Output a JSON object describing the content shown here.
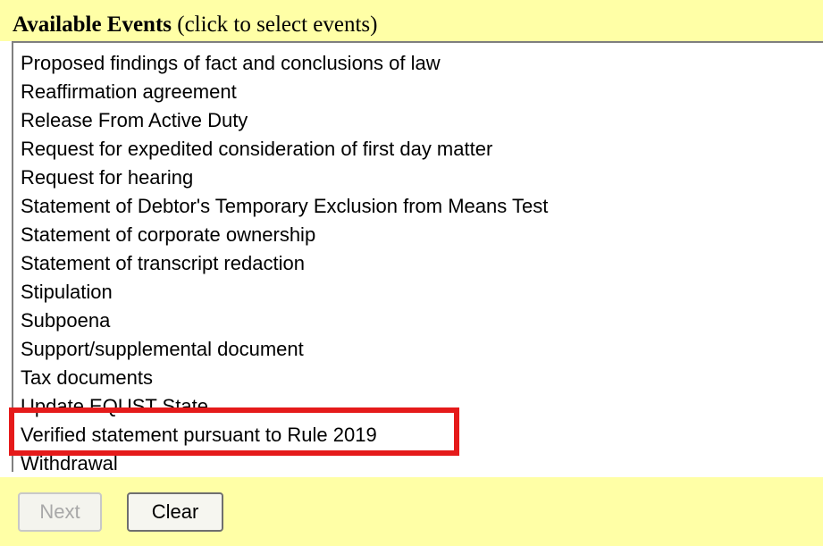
{
  "header": {
    "title": "Available Events",
    "hint": "(click to select events)"
  },
  "events": [
    "Proposed findings of fact and conclusions of law",
    "Reaffirmation agreement",
    "Release From Active Duty",
    "Request for expedited consideration of first day matter",
    "Request for hearing",
    "Statement of Debtor's Temporary Exclusion from Means Test",
    "Statement of corporate ownership",
    "Statement of transcript redaction",
    "Stipulation",
    "Subpoena",
    "Support/supplemental document",
    "Tax documents",
    "Update EQUST State",
    "Verified statement pursuant to Rule 2019",
    "Withdrawal"
  ],
  "buttons": {
    "next_label": "Next",
    "clear_label": "Clear"
  },
  "highlighted_event": "Verified statement pursuant to Rule 2019",
  "colors": {
    "panel_background": "#ffffa6",
    "highlight_border": "#e51a1a",
    "disabled_text": "#a8a8a8"
  }
}
